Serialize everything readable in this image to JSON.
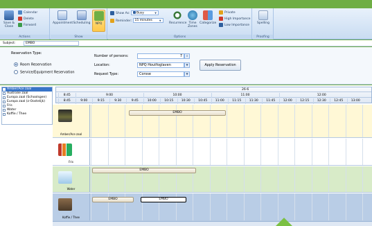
{
  "ribbon": {
    "actions": {
      "label": "Actions",
      "save_close": "Save & Close",
      "calendar": "Calendar",
      "delete": "Delete",
      "forward": "Forward"
    },
    "show": {
      "label": "Show",
      "appointment": "Appointment",
      "scheduling": "Scheduling",
      "npq": "NPQ"
    },
    "options": {
      "label": "Options",
      "show_as_label": "Show As:",
      "show_as_value": "Busy",
      "reminder_label": "Reminder:",
      "reminder_value": "15 minutes",
      "recurrence": "Recurrence",
      "time_zones": "Time Zones",
      "categorize": "Categorize",
      "private": "Private",
      "high_importance": "High Importance",
      "low_importance": "Low Importance"
    },
    "proofing": {
      "label": "Proofing",
      "spelling": "Spelling"
    }
  },
  "subject": {
    "label": "Subject:",
    "value": "EMBO"
  },
  "form": {
    "reservation_type_label": "Reservation Type:",
    "room_reservation": "Room Reservation",
    "service_reservation": "Service/Equipment Reservation",
    "number_of_persons_label": "Number of persons:",
    "number_of_persons_value": "7",
    "location_label": "Location:",
    "location_value": "NPQ Houtfoglaven",
    "request_type_label": "Request Type:",
    "request_type_value": "Corsse",
    "apply_button": "Apply Reservation"
  },
  "rooms": [
    {
      "label": "Amber/Ace zaal",
      "selected": true
    },
    {
      "label": "Australie zaal",
      "selected": false
    },
    {
      "label": "Europa zaal (Schoolsgen)",
      "selected": false
    },
    {
      "label": "Europa zaal (z-Oostelijk)",
      "selected": false
    },
    {
      "label": "Fris",
      "selected": false
    },
    {
      "label": "Water",
      "selected": false
    },
    {
      "label": "Koffie / Thee",
      "selected": false
    }
  ],
  "timeline": {
    "date": "26-6",
    "hours": [
      "8:45",
      "9:00",
      "10:00",
      "11:00",
      "12:00"
    ],
    "quarters": [
      "8:45",
      "9:00",
      "9:15",
      "9:30",
      "9:45",
      "10:00",
      "10:15",
      "10:30",
      "10:45",
      "11:00",
      "11:15",
      "11:30",
      "11:45",
      "12:00",
      "12:15",
      "12:30",
      "12:45",
      "13:00"
    ]
  },
  "resource_rows": [
    {
      "name": "Amber/Ace zaal",
      "appointments": [
        "EMBO"
      ]
    },
    {
      "name": "Fris",
      "appointments": []
    },
    {
      "name": "Water",
      "appointments": [
        "EMBO"
      ]
    },
    {
      "name": "Koffie / Thee",
      "appointments": [
        "EMBO",
        "EMBO"
      ]
    }
  ],
  "colors": {
    "row_amber": "#fff8d6",
    "row_fris": "#ffffff",
    "row_water": "#d8ebc8",
    "row_koffie": "#b9cde6"
  }
}
